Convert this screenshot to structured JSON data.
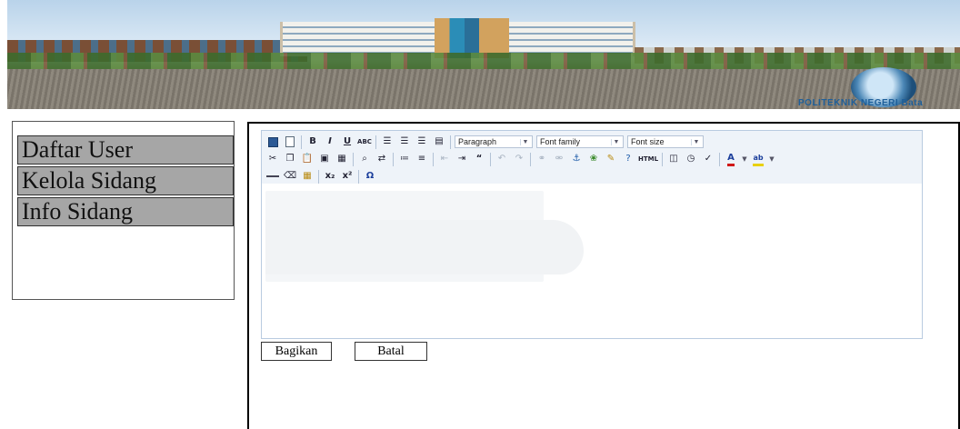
{
  "banner": {
    "org_name": "POLITEKNIK NEGERI Bata"
  },
  "menu": {
    "items": [
      {
        "label": "Daftar User"
      },
      {
        "label": "Kelola Sidang"
      },
      {
        "label": "Info Sidang"
      }
    ]
  },
  "editor": {
    "format_select": "Paragraph",
    "font_family_select": "Font family",
    "font_size_select": "Font size",
    "content": ""
  },
  "actions": {
    "share_label": "Bagikan",
    "cancel_label": "Batal"
  },
  "icons": {
    "toolbar_row1": [
      "save-icon",
      "new-document-icon",
      "bold-icon",
      "italic-icon",
      "underline-icon",
      "strikethrough-icon",
      "align-left-icon",
      "align-center-icon",
      "align-right-icon",
      "align-justify-icon"
    ],
    "toolbar_row2": [
      "cut-icon",
      "copy-icon",
      "paste-icon",
      "paste-text-icon",
      "paste-word-icon",
      "find-icon",
      "replace-icon",
      "bullet-list-icon",
      "numbered-list-icon",
      "outdent-icon",
      "indent-icon",
      "blockquote-icon",
      "undo-icon",
      "redo-icon",
      "link-icon",
      "unlink-icon",
      "anchor-icon",
      "image-icon",
      "cleanup-icon",
      "help-icon",
      "html-icon",
      "preview-icon",
      "time-icon",
      "spellcheck-icon",
      "text-color-icon",
      "background-color-icon"
    ],
    "toolbar_row3": [
      "horizontal-rule-icon",
      "remove-format-icon",
      "table-icon",
      "subscript-icon",
      "superscript-icon",
      "special-char-icon"
    ]
  }
}
